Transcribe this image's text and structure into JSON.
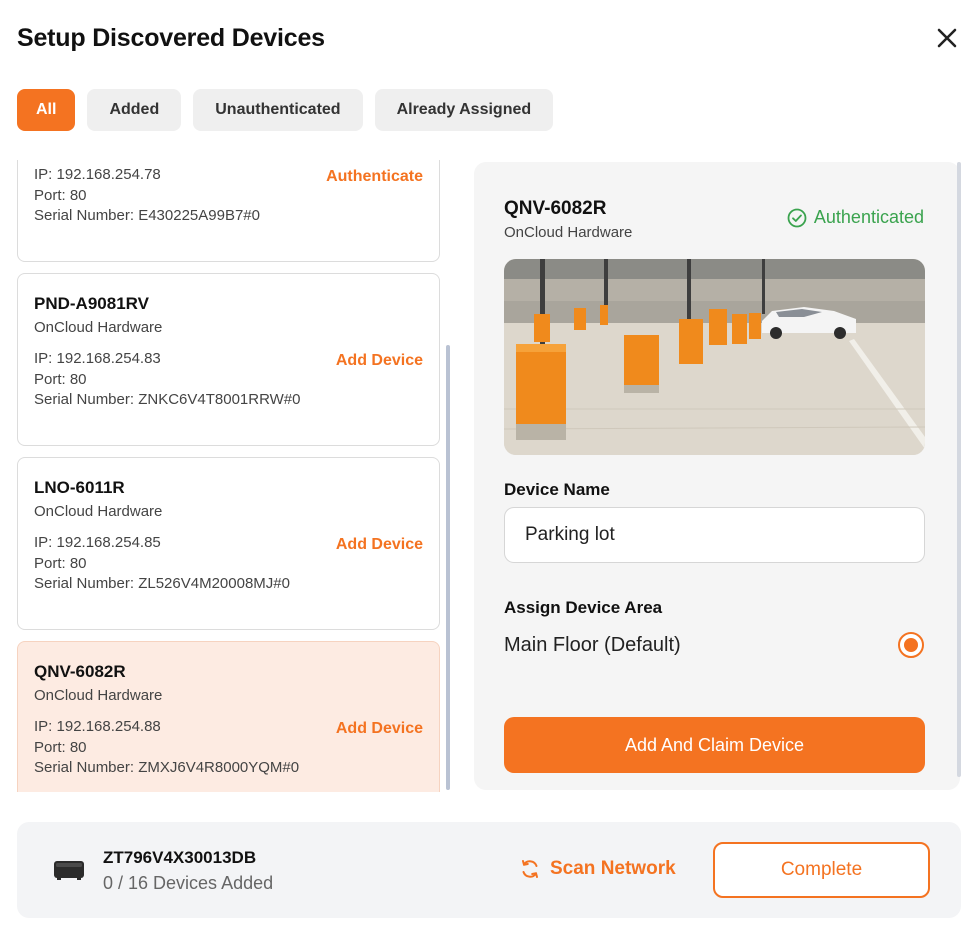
{
  "header": {
    "title": "Setup Discovered Devices",
    "close_icon": "close-icon"
  },
  "tabs": [
    {
      "label": "All",
      "active": true
    },
    {
      "label": "Added",
      "active": false
    },
    {
      "label": "Unauthenticated",
      "active": false
    },
    {
      "label": "Already Assigned",
      "active": false
    }
  ],
  "devices": [
    {
      "model": "",
      "vendor": "",
      "ip": "IP: 192.168.254.78",
      "port": "Port: 80",
      "serial": "Serial Number: E430225A99B7#0",
      "action": "Authenticate"
    },
    {
      "model": "PND-A9081RV",
      "vendor": "OnCloud Hardware",
      "ip": "IP: 192.168.254.83",
      "port": "Port: 80",
      "serial": "Serial Number: ZNKC6V4T8001RRW#0",
      "action": "Add Device"
    },
    {
      "model": "LNO-6011R",
      "vendor": "OnCloud Hardware",
      "ip": "IP: 192.168.254.85",
      "port": "Port: 80",
      "serial": "Serial Number: ZL526V4M20008MJ#0",
      "action": "Add Device"
    },
    {
      "model": "QNV-6082R",
      "vendor": "OnCloud Hardware",
      "ip": "IP: 192.168.254.88",
      "port": "Port: 80",
      "serial": "Serial Number: ZMXJ6V4R8000YQM#0",
      "action": "Add Device",
      "selected": true
    }
  ],
  "detail": {
    "model": "QNV-6082R",
    "vendor": "OnCloud Hardware",
    "status": "Authenticated",
    "status_color": "#3aa34e",
    "device_name_label": "Device Name",
    "device_name_value": "Parking lot",
    "area_label": "Assign Device Area",
    "area_option": "Main Floor (Default)",
    "area_selected": true,
    "claim_button": "Add And Claim Device"
  },
  "footer": {
    "hub_id": "ZT796V4X30013DB",
    "devices_added": "0 / 16 Devices Added",
    "scan_label": "Scan Network",
    "complete_label": "Complete"
  },
  "colors": {
    "accent": "#f47321",
    "selected_bg": "#fdebe2",
    "success": "#3aa34e"
  }
}
